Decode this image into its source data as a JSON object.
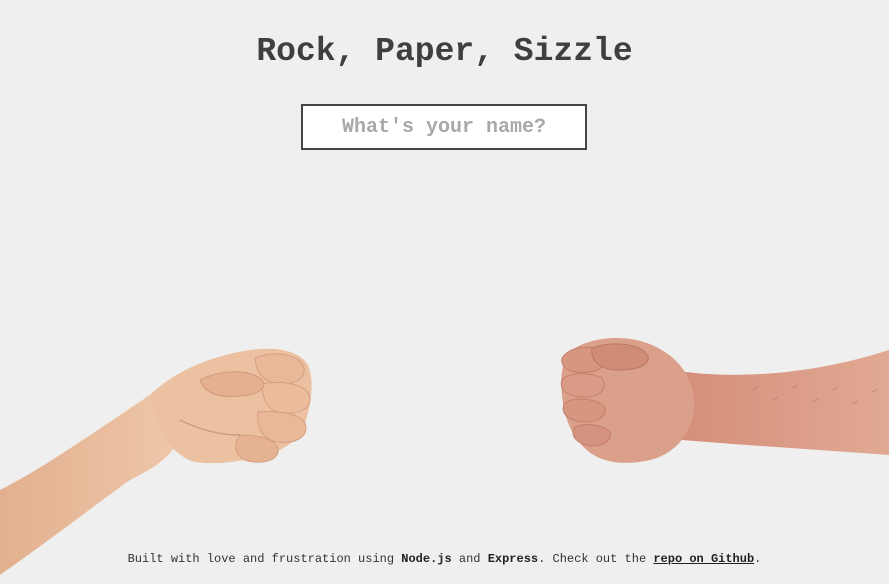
{
  "header": {
    "title": "Rock, Paper, Sizzle"
  },
  "name_form": {
    "placeholder": "What's your name?",
    "value": ""
  },
  "hands": {
    "left": {
      "icon": "left-fist-icon",
      "gesture": "rock"
    },
    "right": {
      "icon": "right-fist-icon",
      "gesture": "rock"
    }
  },
  "footer": {
    "text_1": "Built with love and frustration using ",
    "tech_1": "Node.js",
    "text_2": " and ",
    "tech_2": "Express",
    "text_3": ". Check out the ",
    "link_label": "repo on Github",
    "text_4": "."
  },
  "colors": {
    "background": "#efefef",
    "text": "#3f3f3f",
    "input_border": "#444444",
    "input_background": "#ffffff",
    "placeholder": "#a8a8a8",
    "skin_left": "#e7b99a",
    "skin_right": "#d99a84"
  }
}
